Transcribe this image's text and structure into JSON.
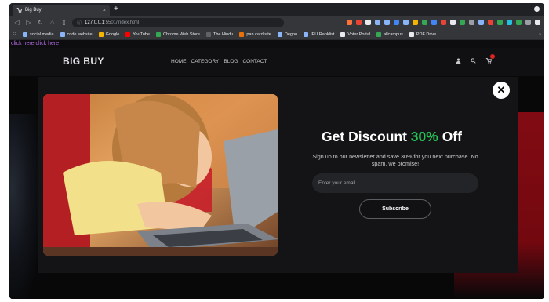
{
  "browser": {
    "tab_title": "Big Buy",
    "tab_close": "×",
    "new_tab": "+",
    "url_host": "127.0.0.1",
    "url_path": ":5501/index.html",
    "bookmarks": [
      {
        "label": "social media",
        "color": "#8ab4f8"
      },
      {
        "label": "code website",
        "color": "#8ab4f8"
      },
      {
        "label": "Google",
        "color": "#f4b400"
      },
      {
        "label": "YouTube",
        "color": "#ff0000"
      },
      {
        "label": "Chrome Web Store",
        "color": "#34a853"
      },
      {
        "label": "The Hindu",
        "color": "#5f6368"
      },
      {
        "label": "pan card site",
        "color": "#e8710a"
      },
      {
        "label": "Degoo",
        "color": "#8ab4f8"
      },
      {
        "label": "IPU Ranklist",
        "color": "#8ab4f8"
      },
      {
        "label": "Voter Portal",
        "color": "#e8eaed"
      },
      {
        "label": "allcampus",
        "color": "#34a853"
      },
      {
        "label": "PDF Drive",
        "color": "#e8eaed"
      }
    ],
    "bookmarks_more": "»",
    "extension_colors": [
      "#ff7139",
      "#ea4335",
      "#e8eaed",
      "#8ab4f8",
      "#8ab4f8",
      "#4285f4",
      "#8ab4f8",
      "#f4b400",
      "#34a853",
      "#4285f4",
      "#ea4335",
      "#e8eaed",
      "#34a853",
      "#9aa0a6",
      "#8ab4f8",
      "#ea4335",
      "#34a853",
      "#24c1e0",
      "#34a853",
      "#9aa0a6",
      "#e8eaed"
    ]
  },
  "page": {
    "top_note": "click here click here",
    "logo": "BIG BUY",
    "nav": [
      "HOME",
      "CATEGORY",
      "BLOG",
      "CONTACT"
    ]
  },
  "modal": {
    "title_prefix": "Get Discount ",
    "title_highlight": "30%",
    "title_suffix": " Off",
    "subtitle": "Sign up to our newsletter and save 30% for you next purchase. No spam, we promise!",
    "email_placeholder": "Enter your email...",
    "subscribe_label": "Subscribe",
    "close_symbol": "✕",
    "photo_icon": "girl-with-laptop-photo"
  },
  "colors": {
    "accent_green": "#24c255",
    "background": "#0d0d0f",
    "modal_bg": "#141416"
  }
}
